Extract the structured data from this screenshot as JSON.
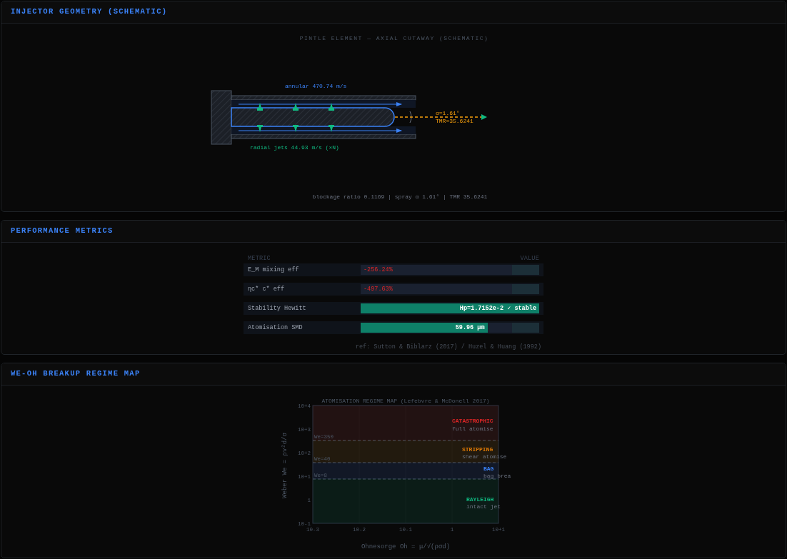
{
  "panels": [
    {
      "kind": "geometry",
      "title": "INJECTOR GEOMETRY (SCHEMATIC)"
    },
    {
      "kind": "metrics",
      "title": "PERFORMANCE METRICS"
    },
    {
      "kind": "regime",
      "title": "WE-OH BREAKUP REGIME MAP"
    }
  ],
  "geometry": {
    "caption": "PINTLE ELEMENT — AXIAL CUTAWAY (SCHEMATIC)",
    "annular": "annular 470.74 m/s",
    "radial": "radial jets 44.93 m/s (×N)",
    "angle": "α=1.61°",
    "tmr": "TMR=35.6241",
    "footer": "blockage ratio 0.1169 | spray α 1.61° | TMR 35.6241"
  },
  "metrics": {
    "columns": [
      "METRIC",
      "VALUE"
    ],
    "rows": [
      {
        "label": "E_M  mixing eff",
        "value": "-256.24%",
        "kind": "negative"
      },
      {
        "label": "ηc*  c* eff",
        "value": "-497.63%",
        "kind": "negative"
      },
      {
        "label": "Stability  Hewitt",
        "value": "Hp=1.7152e-2  ✓ stable",
        "kind": "good",
        "level": 1
      },
      {
        "label": "Atomisation  SMD",
        "value": "59.96 µm",
        "kind": "good",
        "level": 0.71
      }
    ],
    "reference": "ref: Sutton & Biblarz (2017) / Huzel & Huang (1992)"
  },
  "regime_map": {
    "title": "ATOMISATION REGIME MAP  (Lefebvre & McDonell 2017)",
    "ylabel": "Weber  We = ρv²d/σ",
    "xlabel": "Ohnesorge  Oh = μ/√(ρσd)",
    "yticks": [
      "10+4",
      "10+3",
      "10+2",
      "10+1",
      "1",
      "10-1"
    ],
    "xticks": [
      "10-3",
      "10-2",
      "10-1",
      "1",
      "10+1"
    ],
    "thresholds": [
      "We=350",
      "We=40",
      "We=8"
    ],
    "regimes": [
      {
        "name": "CATASTROPHIC",
        "description": "full atomise",
        "color": "#dc2626"
      },
      {
        "name": "STRIPPING",
        "description": "shear atomise",
        "color": "#d97706"
      },
      {
        "name": "BAG",
        "description": "bag brea",
        "color": "#3b82f6"
      },
      {
        "name": "RAYLEIGH",
        "description": "intact jet",
        "color": "#10b981"
      }
    ]
  }
}
